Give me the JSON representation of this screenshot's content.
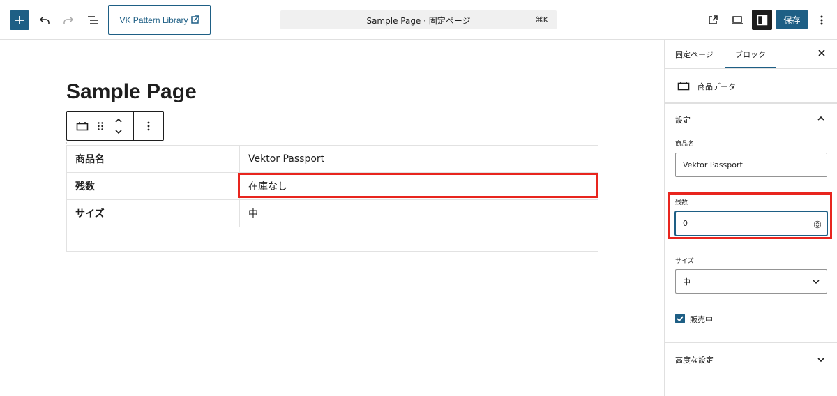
{
  "topbar": {
    "vk_button_label": "VK Pattern Library",
    "command_title": "Sample Page · 固定ページ",
    "command_shortcut": "⌘K",
    "save_label": "保存"
  },
  "canvas": {
    "page_title": "Sample Page",
    "table": {
      "rows": [
        {
          "label": "商品名",
          "value": "Vektor Passport"
        },
        {
          "label": "残数",
          "value": "在庫なし"
        },
        {
          "label": "サイズ",
          "value": "中"
        }
      ]
    }
  },
  "sidebar": {
    "tabs": [
      "固定ページ",
      "ブロック"
    ],
    "active_tab": "ブロック",
    "block_name": "商品データ",
    "settings_title": "設定",
    "fields": {
      "name_label": "商品名",
      "name_value": "Vektor Passport",
      "stock_label": "残数",
      "stock_value": "0",
      "size_label": "サイズ",
      "size_value": "中",
      "on_sale_label": "販売中",
      "on_sale_checked": true
    },
    "advanced_title": "高度な設定"
  },
  "colors": {
    "accent": "#1e5f85",
    "highlight": "#e8251e"
  }
}
